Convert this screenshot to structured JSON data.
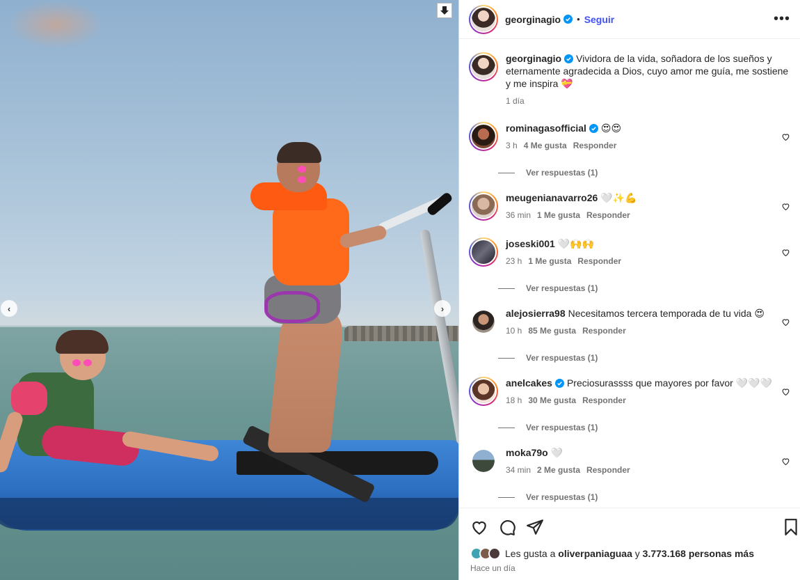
{
  "post": {
    "username": "georginagio",
    "follow_label": "Seguir",
    "separator": "•",
    "more_label": "•••"
  },
  "caption": {
    "username": "georginagio",
    "text": "Vividora de la vida, soñadora de los sueños y eternamente agradecida a Dios, cuyo amor me guía, me sostiene y me inspira 💝",
    "time": "1 día"
  },
  "comments": [
    {
      "username": "rominagasofficial",
      "verified": true,
      "text": "😍😍",
      "time": "3 h",
      "likes": "4 Me gusta",
      "reply": "Responder",
      "replies": "Ver respuestas (1)"
    },
    {
      "username": "meugenianavarro26",
      "verified": false,
      "text": "🤍✨💪",
      "time": "36 min",
      "likes": "1 Me gusta",
      "reply": "Responder",
      "replies": ""
    },
    {
      "username": "joseski001",
      "verified": false,
      "text": "🤍🙌🙌",
      "time": "23 h",
      "likes": "1 Me gusta",
      "reply": "Responder",
      "replies": "Ver respuestas (1)"
    },
    {
      "username": "alejosierra98",
      "verified": false,
      "text": "Necesitamos tercera temporada de tu vida 😍",
      "time": "10 h",
      "likes": "85 Me gusta",
      "reply": "Responder",
      "replies": "Ver respuestas (1)"
    },
    {
      "username": "anelcakes",
      "verified": true,
      "text": "Preciosurassss que mayores por favor 🤍🤍🤍",
      "time": "18 h",
      "likes": "30 Me gusta",
      "reply": "Responder",
      "replies": "Ver respuestas (1)"
    },
    {
      "username": "moka79o",
      "verified": false,
      "text": "🤍",
      "time": "34 min",
      "likes": "2 Me gusta",
      "reply": "Responder",
      "replies": "Ver respuestas (1)"
    }
  ],
  "likes": {
    "prefix": "Les gusta a",
    "user": "oliverpaniaguaa",
    "middle": "y",
    "count": "3.773.168 personas más"
  },
  "posted": "Hace un día",
  "carousel": {
    "prev": "‹",
    "next": "›"
  },
  "colors": {
    "follow": "#4150f7",
    "verified": "#0095f6",
    "meta": "#737373"
  }
}
